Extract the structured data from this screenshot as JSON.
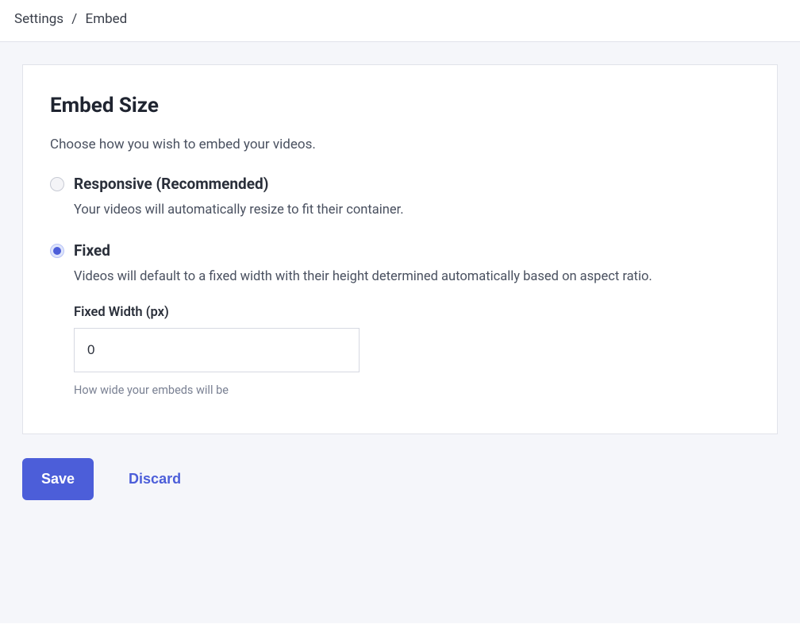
{
  "breadcrumb": {
    "parent": "Settings",
    "separator": "/",
    "current": "Embed"
  },
  "card": {
    "title": "Embed Size",
    "intro": "Choose how you wish to embed your videos."
  },
  "options": {
    "responsive": {
      "label": "Responsive (Recommended)",
      "description": "Your videos will automatically resize to fit their container.",
      "selected": false
    },
    "fixed": {
      "label": "Fixed",
      "description": "Videos will default to a fixed width with their height determined automatically based on aspect ratio.",
      "selected": true,
      "field": {
        "label": "Fixed Width (px)",
        "value": "0",
        "help": "How wide your embeds will be"
      }
    }
  },
  "actions": {
    "save": "Save",
    "discard": "Discard"
  }
}
